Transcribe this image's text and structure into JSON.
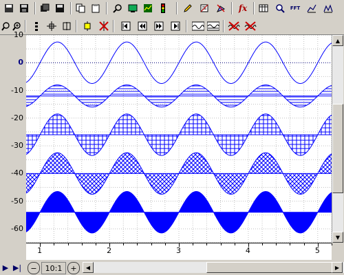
{
  "toolbar_top": {
    "buttons": [
      {
        "name": "open-icon"
      },
      {
        "name": "save-icon"
      },
      {
        "name": "copy-icon"
      },
      {
        "name": "save-as-icon"
      },
      {
        "name": "copy-clipboard-icon"
      },
      {
        "name": "paste-icon"
      },
      {
        "name": "zoom-tool-icon"
      },
      {
        "name": "monitor-icon"
      },
      {
        "name": "chart-icon"
      },
      {
        "name": "traffic-light-icon"
      },
      {
        "name": "edit-icon"
      },
      {
        "name": "notes-icon"
      },
      {
        "name": "paint-icon"
      },
      {
        "name": "function-icon"
      },
      {
        "name": "table-icon"
      },
      {
        "name": "zoom-search-icon"
      },
      {
        "name": "fft-icon"
      },
      {
        "name": "line-chart-icon"
      },
      {
        "name": "histogram-icon"
      }
    ],
    "function_label": "fx",
    "fft_label": "FFT"
  },
  "toolbar_second": {
    "buttons": [
      {
        "name": "zoom-in-out-icon"
      },
      {
        "name": "zoom-fit-icon"
      },
      {
        "name": "vertical-bars-icon"
      },
      {
        "name": "marker-icon"
      },
      {
        "name": "move-cursor-icon"
      },
      {
        "name": "delete-cursor-icon"
      },
      {
        "name": "first-icon"
      },
      {
        "name": "prev-icon"
      },
      {
        "name": "next-icon"
      },
      {
        "name": "last-icon"
      },
      {
        "name": "wave-1-icon"
      },
      {
        "name": "wave-2-icon"
      },
      {
        "name": "delete-wave-1-icon"
      },
      {
        "name": "delete-wave-2-icon"
      }
    ]
  },
  "chart_data": {
    "type": "line",
    "y_ticks": [
      "10",
      "0",
      "-10",
      "-20",
      "-30",
      "-40",
      "-50",
      "-60"
    ],
    "x_ticks": [
      "1",
      "2",
      "3",
      "4",
      "5"
    ],
    "ylim": [
      -65,
      10
    ],
    "xlim": [
      0.8,
      5.2
    ],
    "grid": true,
    "series": [
      {
        "offset": 0,
        "amplitude": 7.5,
        "fill": "none"
      },
      {
        "offset": -12,
        "amplitude": 4,
        "fill": "horizontal-hatch"
      },
      {
        "offset": -26,
        "amplitude": 7.5,
        "fill": "grid-hatch"
      },
      {
        "offset": -40,
        "amplitude": 7.5,
        "fill": "crosshatch"
      },
      {
        "offset": -54,
        "amplitude": 7.5,
        "fill": "solid"
      }
    ],
    "period": 1.0,
    "color": "#0000ff"
  },
  "bottom": {
    "zoom_label": "10:1"
  }
}
